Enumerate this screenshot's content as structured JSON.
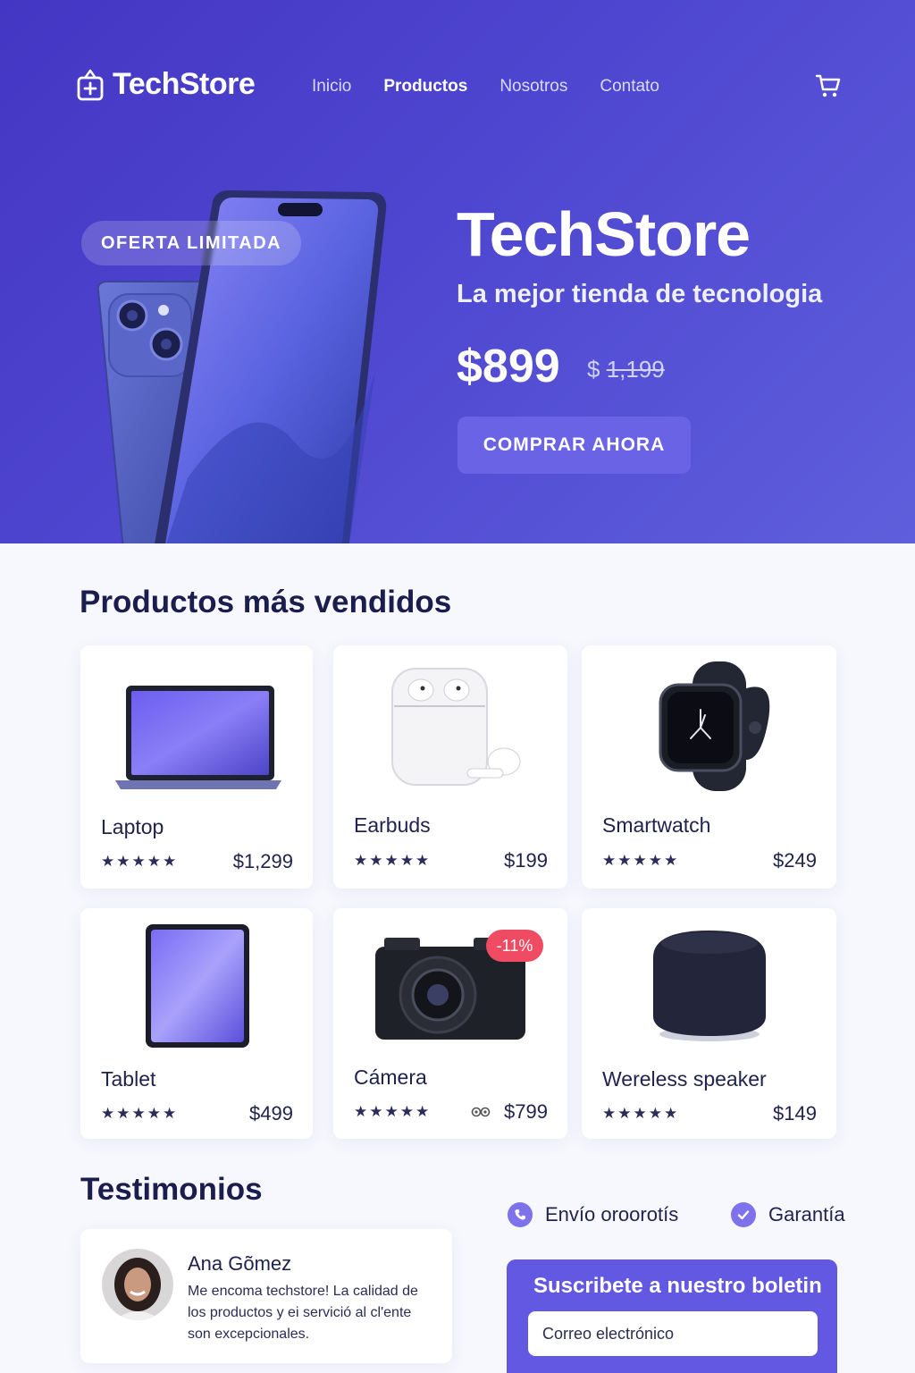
{
  "brand": {
    "name": "TechStore"
  },
  "nav": {
    "links": [
      {
        "label": "Inicio",
        "active": false
      },
      {
        "label": "Productos",
        "active": true
      },
      {
        "label": "Nosotros",
        "active": false
      },
      {
        "label": "Contato",
        "active": false
      }
    ],
    "cart_icon": "cart-icon"
  },
  "hero": {
    "badge": "OFERTA LIMITADA",
    "title": "TechStore",
    "subtitle": "La mejor tienda de tecnologia",
    "price": "$899",
    "old_price_symbol": "$",
    "old_price_value": "1,199",
    "cta": "COMPRAR AHORA"
  },
  "products": {
    "title": "Productos más vendidos",
    "items": [
      {
        "name": "Laptop",
        "stars": "★★★★★",
        "price": "$1,299"
      },
      {
        "name": "Earbuds",
        "stars": "★★★★★",
        "price": "$199"
      },
      {
        "name": "Smartwatch",
        "stars": "★★★★★",
        "price": "$249"
      },
      {
        "name": "Tablet",
        "stars": "★★★★★",
        "price": "$499"
      },
      {
        "name": "Cámera",
        "stars": "★★★★★",
        "price": "$799",
        "badge": "-11%",
        "extra_icon": "view-icon"
      },
      {
        "name": "Wereless speaker",
        "stars": "★★★★★",
        "price": "$149"
      }
    ]
  },
  "testimonials": {
    "title": "Testimonios",
    "items": [
      {
        "name": "Ana Gõmez",
        "text": "Me encoma techstore! La calidad de los productos y ei servició al cl'ente son excepcionales."
      }
    ]
  },
  "features": [
    {
      "label": "Envío oroorotís",
      "icon": "phone-icon"
    },
    {
      "label": "Garantía",
      "icon": "check-icon"
    }
  ],
  "newsletter": {
    "title": "Suscribete a nuestro boletin",
    "placeholder": "Correo electrónico"
  },
  "colors": {
    "hero_start": "#4436c4",
    "hero_end": "#5f5fdc",
    "accent": "#6a63e6",
    "discount": "#ef4b62",
    "text_dark": "#1a1d4d"
  }
}
